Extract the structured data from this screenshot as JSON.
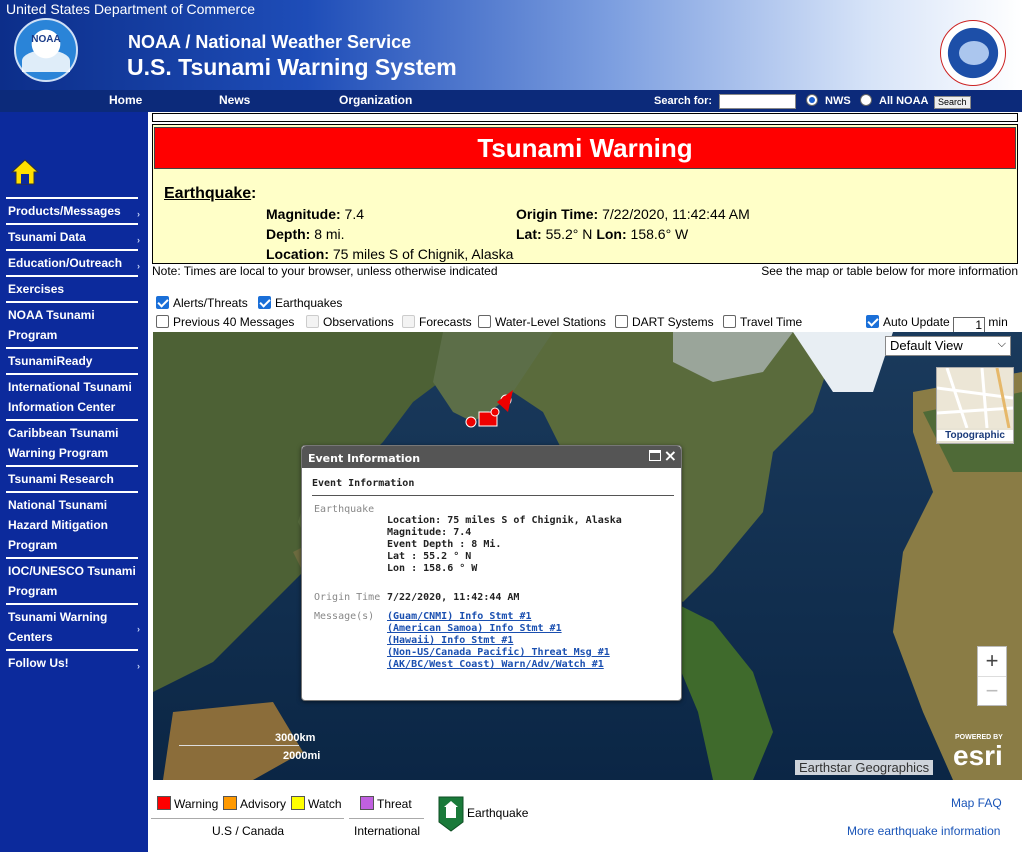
{
  "header": {
    "dept": "United States Department of Commerce",
    "noaa_logo_text": "NOAA",
    "agency": "NOAA / National Weather Service",
    "system": "U.S. Tsunami Warning System"
  },
  "nav": {
    "items": [
      "Home",
      "News",
      "Organization"
    ],
    "search_label": "Search for:",
    "search_value": "",
    "radio_nws": "NWS",
    "radio_all": "All NOAA",
    "search_button": "Search"
  },
  "sidebar": {
    "items": [
      {
        "label": "Products/Messages",
        "arrow": "›"
      },
      {
        "label": "Tsunami Data",
        "arrow": "›"
      },
      {
        "label": "Education/Outreach",
        "arrow": "›"
      },
      {
        "label": "Exercises",
        "arrow": ""
      },
      {
        "label": "NOAA Tsunami Program",
        "arrow": ""
      },
      {
        "label": "TsunamiReady",
        "arrow": ""
      },
      {
        "label": "International Tsunami Information Center",
        "arrow": ""
      },
      {
        "label": "Caribbean Tsunami Warning Program",
        "arrow": ""
      },
      {
        "label": "Tsunami Research",
        "arrow": ""
      },
      {
        "label": "National Tsunami Hazard Mitigation Program",
        "arrow": ""
      },
      {
        "label": "IOC/UNESCO Tsunami Program",
        "arrow": ""
      },
      {
        "label": "Tsunami Warning Centers",
        "arrow": "›"
      },
      {
        "label": "Follow Us!",
        "arrow": "›"
      }
    ]
  },
  "warning": {
    "title": "Tsunami Warning",
    "event_label": "Earthquake",
    "magnitude_label": "Magnitude:",
    "magnitude": "7.4",
    "origin_label": "Origin Time:",
    "origin": "7/22/2020, 11:42:44 AM",
    "depth_label": "Depth:",
    "depth": "8 mi.",
    "lat_label": "Lat:",
    "lat": "55.2° N",
    "lon_label": "Lon:",
    "lon": "158.6° W",
    "location_label": "Location:",
    "location": "75 miles S of Chignik, Alaska"
  },
  "notes": {
    "left": "Note: Times are local to your browser, unless otherwise indicated",
    "right": "See the map or table below for more information"
  },
  "toggles": {
    "alerts": "Alerts/Threats",
    "earthquakes": "Earthquakes",
    "previous": "Previous 40 Messages",
    "observations": "Observations",
    "forecasts": "Forecasts",
    "water": "Water-Level Stations",
    "dart": "DART Systems",
    "travel": "Travel Time",
    "auto": "Auto Update",
    "auto_value": "1",
    "min": "min"
  },
  "map": {
    "view_select": "Default View",
    "basemap_label": "Topographic",
    "scale_km": "3000km",
    "scale_mi": "2000mi",
    "attribution": "Earthstar Geographics",
    "esri_powered": "POWERED BY",
    "esri": "esri",
    "zoom_in": "+",
    "zoom_out": "−"
  },
  "popup": {
    "title": "Event Information",
    "section": "Event Information",
    "eq_label": "Earthquake",
    "location": "Location: 75 miles S of Chignik, Alaska",
    "magnitude": "Magnitude: 7.4",
    "depth": "Event Depth : 8 Mi.",
    "lat": "Lat : 55.2 ° N",
    "lon": "Lon : 158.6 ° W",
    "origin_label": "Origin Time",
    "origin": "7/22/2020, 11:42:44 AM",
    "messages_label": "Message(s)",
    "messages": [
      "(Guam/CNMI) Info Stmt #1",
      "(American Samoa) Info Stmt #1",
      "(Hawaii) Info Stmt #1",
      "(Non-US/Canada Pacific) Threat Msg #1",
      "(AK/BC/West Coast) Warn/Adv/Watch #1"
    ]
  },
  "legend": {
    "warning": "Warning",
    "advisory": "Advisory",
    "watch": "Watch",
    "us_canada": "U.S / Canada",
    "threat": "Threat",
    "international": "International",
    "earthquake": "Earthquake",
    "faq": "Map FAQ",
    "more": "More earthquake information",
    "colors": {
      "warning": "#ff0000",
      "advisory": "#ff9900",
      "watch": "#ffff00",
      "threat": "#c060e0"
    }
  }
}
